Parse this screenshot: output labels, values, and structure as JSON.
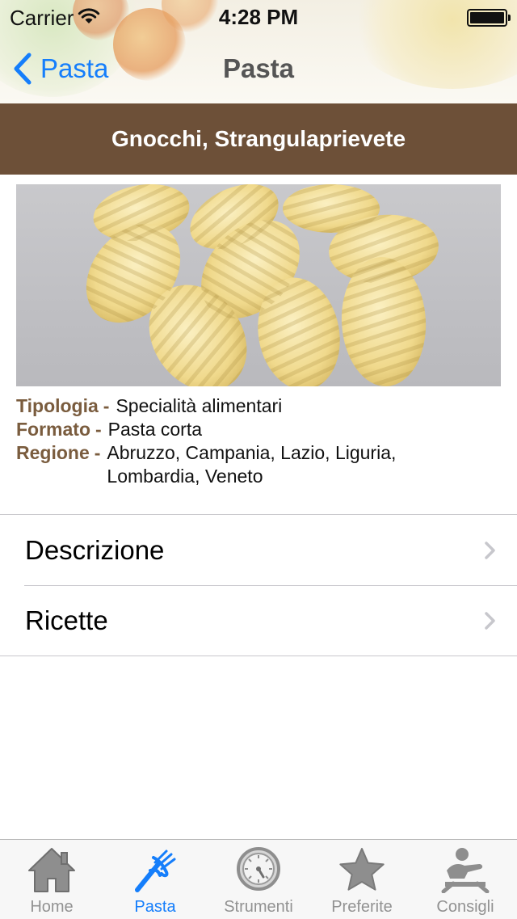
{
  "status_bar": {
    "carrier": "Carrier",
    "time": "4:28 PM"
  },
  "nav": {
    "back_label": "Pasta",
    "title": "Pasta"
  },
  "product": {
    "name": "Gnocchi, Strangulaprievete",
    "details": [
      {
        "label": "Tipologia",
        "separator": "-",
        "value": "Specialità alimentari"
      },
      {
        "label": "Formato",
        "separator": "-",
        "value": "Pasta corta"
      },
      {
        "label": "Regione",
        "separator": "-",
        "value": "Abruzzo, Campania, Lazio, Liguria, Lombardia, Veneto"
      }
    ]
  },
  "rows": [
    {
      "label": "Descrizione"
    },
    {
      "label": "Ricette"
    }
  ],
  "tabs": [
    {
      "label": "Home",
      "icon": "house-icon",
      "active": false
    },
    {
      "label": "Pasta",
      "icon": "pasta-fork-icon",
      "active": true
    },
    {
      "label": "Strumenti",
      "icon": "timer-dial-icon",
      "active": false
    },
    {
      "label": "Preferite",
      "icon": "star-icon",
      "active": false
    },
    {
      "label": "Consigli",
      "icon": "chef-icon",
      "active": false
    }
  ],
  "colors": {
    "accent": "#157efb",
    "banner": "#6d5038",
    "label_brown": "#7a5c3e",
    "tab_inactive": "#929292"
  }
}
